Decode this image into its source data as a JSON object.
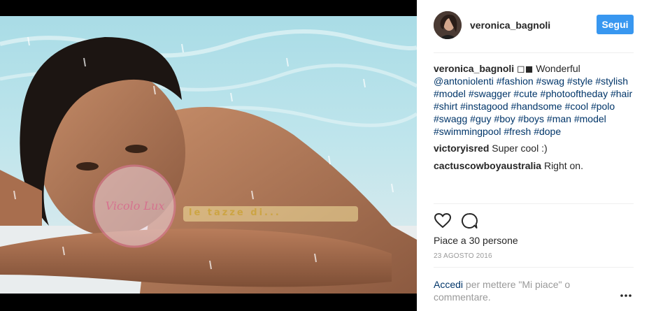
{
  "post": {
    "username": "veronica_bagnoli",
    "follow_label": "Segui",
    "caption_user": "veronica_bagnoli",
    "caption_glyphs": "◻◼",
    "caption_text": "Wonderful",
    "caption_tags": [
      "@antoniolenti",
      "#fashion",
      "#swag",
      "#style",
      "#stylish",
      "#model",
      "#swagger",
      "#cute",
      "#photooftheday",
      "#hair",
      "#shirt",
      "#instagood",
      "#handsome",
      "#cool",
      "#polo",
      "#swagg",
      "#guy",
      "#boy",
      "#boys",
      "#man",
      "#model",
      "#swimmingpool",
      "#fresh",
      "#dope"
    ],
    "comments": [
      {
        "user": "victoryisred",
        "text": "Super cool :)"
      },
      {
        "user": "cactuscowboyaustralia",
        "text": "Right on."
      }
    ],
    "likes": "Piace a 30 persone",
    "date": "23 AGOSTO 2016",
    "login_link": "Accedi",
    "login_text": "per mettere \"Mi piace\" o commentare."
  },
  "photo": {
    "watermark_circle_text": "Vicolo Lux",
    "watermark_banner_text": "le tazze di..."
  },
  "icons": {
    "like": "heart-icon",
    "comment": "speech-bubble-icon",
    "more": "more-options-icon"
  },
  "colors": {
    "follow_button": "#3897f0",
    "hashtag": "#003569",
    "muted": "#999999"
  }
}
